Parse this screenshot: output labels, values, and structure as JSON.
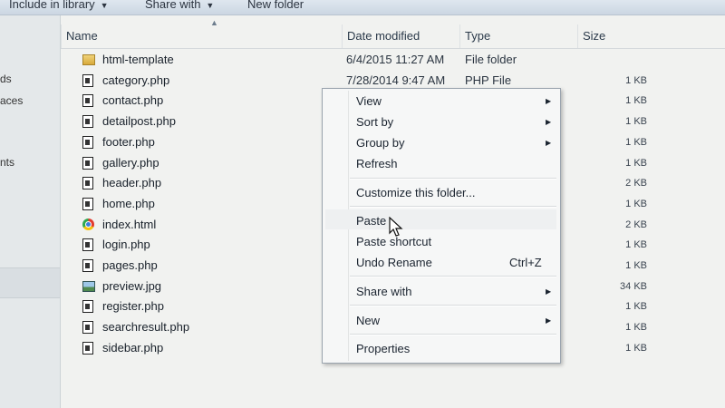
{
  "toolbar": {
    "include_label": "Include in library",
    "share_label": "Share with",
    "new_folder_label": "New folder"
  },
  "nav": {
    "items": [
      "ds",
      "aces",
      "nts"
    ]
  },
  "columns": {
    "name": "Name",
    "date": "Date modified",
    "type": "Type",
    "size": "Size"
  },
  "files": [
    {
      "name": "html-template",
      "date": "6/4/2015 11:27 AM",
      "type": "File folder",
      "size": "",
      "icon": "folder-icon"
    },
    {
      "name": "category.php",
      "date": "7/28/2014 9:47 AM",
      "type": "PHP File",
      "size": "1 KB",
      "icon": "php-file-icon"
    },
    {
      "name": "contact.php",
      "date": "",
      "type": "",
      "size": "1 KB",
      "icon": "php-file-icon"
    },
    {
      "name": "detailpost.php",
      "date": "",
      "type": "",
      "size": "1 KB",
      "icon": "php-file-icon"
    },
    {
      "name": "footer.php",
      "date": "",
      "type": "",
      "size": "1 KB",
      "icon": "php-file-icon"
    },
    {
      "name": "gallery.php",
      "date": "",
      "type": "",
      "size": "1 KB",
      "icon": "php-file-icon"
    },
    {
      "name": "header.php",
      "date": "",
      "type": "",
      "size": "2 KB",
      "icon": "php-file-icon"
    },
    {
      "name": "home.php",
      "date": "",
      "type": "",
      "size": "1 KB",
      "icon": "php-file-icon"
    },
    {
      "name": "index.html",
      "date": "",
      "type": "",
      "size": "2 KB",
      "icon": "chrome-html-icon"
    },
    {
      "name": "login.php",
      "date": "",
      "type": "",
      "size": "1 KB",
      "icon": "php-file-icon"
    },
    {
      "name": "pages.php",
      "date": "",
      "type": "",
      "size": "1 KB",
      "icon": "php-file-icon"
    },
    {
      "name": "preview.jpg",
      "date": "",
      "type": "",
      "size": "34 KB",
      "icon": "jpg-image-icon"
    },
    {
      "name": "register.php",
      "date": "",
      "type": "",
      "size": "1 KB",
      "icon": "php-file-icon"
    },
    {
      "name": "searchresult.php",
      "date": "",
      "type": "",
      "size": "1 KB",
      "icon": "php-file-icon"
    },
    {
      "name": "sidebar.php",
      "date": "",
      "type": "",
      "size": "1 KB",
      "icon": "php-file-icon"
    }
  ],
  "context_menu": {
    "view": "View",
    "sort_by": "Sort by",
    "group_by": "Group by",
    "refresh": "Refresh",
    "customize": "Customize this folder...",
    "paste": "Paste",
    "paste_shortcut": "Paste shortcut",
    "undo_rename": "Undo Rename",
    "undo_shortcut": "Ctrl+Z",
    "share_with": "Share with",
    "new": "New",
    "properties": "Properties"
  },
  "colors": {
    "background": "#f1f2f0",
    "menu_background": "#f6f7f7",
    "toolbar": "#d4dde7"
  }
}
